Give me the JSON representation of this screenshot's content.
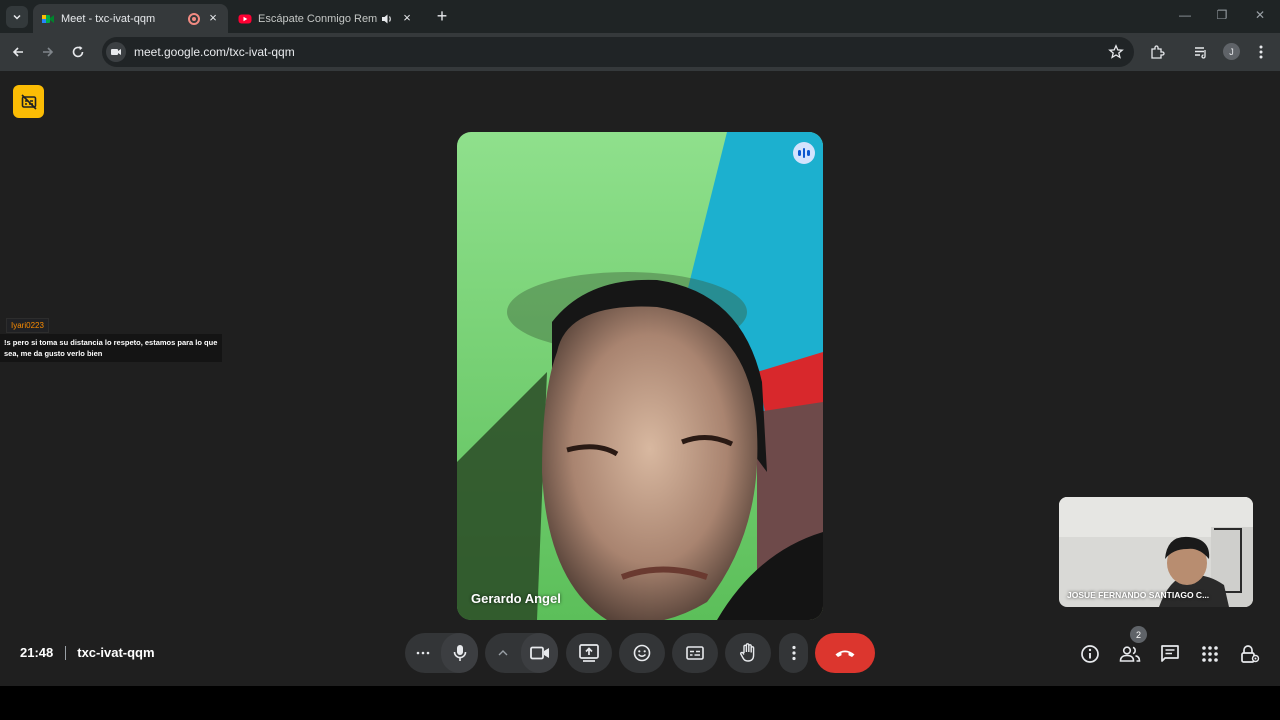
{
  "browser": {
    "tabs": [
      {
        "title": "Meet - txc-ivat-qqm",
        "active": true,
        "recording": true
      },
      {
        "title": "Escápate Conmigo Remix, V",
        "active": false,
        "audio": true
      }
    ],
    "url": "meet.google.com/txc-ivat-qqm",
    "profile_initial": "J"
  },
  "meet": {
    "chat_overlay": {
      "username": "Iyari0223",
      "message": "!s pero si toma su distancia lo respeto, estamos para lo que sea, me da gusto verlo bien"
    },
    "main_participant": {
      "name": "Gerardo Angel"
    },
    "self_participant": {
      "name": "JOSUE FERNANDO SANTIAGO C..."
    },
    "time": "21:48",
    "meeting_code": "txc-ivat-qqm",
    "people_count": "2"
  },
  "colors": {
    "stage_bg": "#1f1f1f",
    "control_bg": "#333537",
    "end_call": "#dc362e",
    "captions_badge": "#fbbc04",
    "chat_username": "#fb8c00"
  },
  "icons": [
    "tab-list-icon",
    "meet-favicon",
    "record-icon",
    "youtube-favicon",
    "audio-icon",
    "close-icon",
    "plus-icon",
    "minimize-icon",
    "restore-icon",
    "back-arrow-icon",
    "forward-arrow-icon",
    "reload-icon",
    "site-info-icon",
    "star-icon",
    "extensions-icon",
    "media-control-icon",
    "more-vert-icon",
    "captions-off-icon",
    "speaking-icon",
    "more-horiz-icon",
    "mic-icon",
    "chevron-up-icon",
    "camera-icon",
    "present-icon",
    "emoji-icon",
    "captions-icon",
    "raise-hand-icon",
    "end-call-icon",
    "info-icon",
    "people-icon",
    "chat-icon",
    "activities-icon",
    "host-controls-icon"
  ]
}
